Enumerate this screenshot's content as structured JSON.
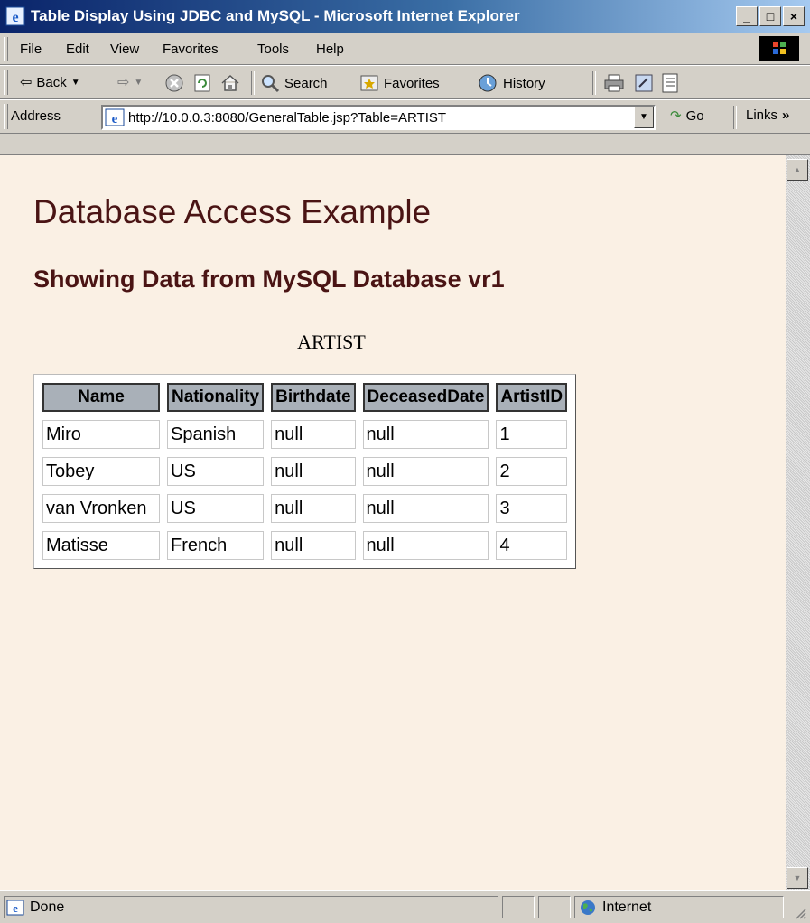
{
  "window": {
    "title": "Table Display Using JDBC and MySQL - Microsoft Internet Explorer",
    "buttons": {
      "minimize": "_",
      "maximize": "□",
      "close": "×"
    }
  },
  "menu": [
    "File",
    "Edit",
    "View",
    "Favorites",
    "Tools",
    "Help"
  ],
  "toolbar": {
    "back": "Back",
    "search": "Search",
    "favorites": "Favorites",
    "history": "History"
  },
  "address": {
    "label": "Address",
    "url": "http://10.0.0.3:8080/GeneralTable.jsp?Table=ARTIST",
    "go": "Go",
    "links": "Links"
  },
  "page": {
    "heading": "Database Access Example",
    "subheading": "Showing Data from MySQL Database vr1",
    "table_caption": "ARTIST",
    "columns": [
      "Name",
      "Nationality",
      "Birthdate",
      "DeceasedDate",
      "ArtistID"
    ],
    "rows": [
      [
        "Miro",
        "Spanish",
        "null",
        "null",
        "1"
      ],
      [
        "Tobey",
        "US",
        "null",
        "null",
        "2"
      ],
      [
        "van Vronken",
        "US",
        "null",
        "null",
        "3"
      ],
      [
        "Matisse",
        "French",
        "null",
        "null",
        "4"
      ]
    ]
  },
  "status": {
    "text": "Done",
    "zone": "Internet"
  },
  "colors": {
    "heading": "#4a1414",
    "page_background": "#faf0e4",
    "header_cell": "#a9b0b8"
  }
}
